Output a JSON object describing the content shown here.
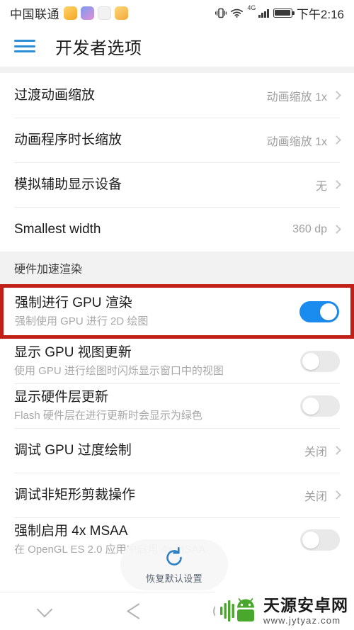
{
  "statusbar": {
    "carrier": "中国联通",
    "app_icons": [
      "app-icon-1",
      "app-icon-2",
      "app-icon-3",
      "app-icon-4"
    ],
    "vibrate_icon": "vibrate-icon",
    "wifi_icon": "wifi-icon",
    "network_type": "4G",
    "signal_icon": "signal-bars-icon",
    "battery_icon": "battery-icon",
    "time": "下午2:16"
  },
  "appbar": {
    "menu_icon": "hamburger-menu-icon",
    "title": "开发者选项"
  },
  "list": [
    {
      "kind": "item",
      "title": "过渡动画缩放",
      "value": "动画缩放 1x"
    },
    {
      "kind": "item",
      "title": "动画程序时长缩放",
      "value": "动画缩放 1x"
    },
    {
      "kind": "item",
      "title": "模拟辅助显示设备",
      "value": "无"
    },
    {
      "kind": "item",
      "title": "Smallest width",
      "value": "360 dp"
    }
  ],
  "section_header": "硬件加速渲染",
  "highlighted_row": {
    "title": "强制进行 GPU 渲染",
    "subtitle": "强制使用 GPU 进行 2D 绘图",
    "toggle_state": "on",
    "highlight_color": "#c02017",
    "toggle_on_color": "#1a8cf0"
  },
  "toggle_rows": [
    {
      "title": "显示 GPU 视图更新",
      "subtitle": "使用 GPU 进行绘图时闪烁显示窗口中的视图",
      "toggle_state": "off"
    },
    {
      "title": "显示硬件层更新",
      "subtitle": "Flash 硬件层在进行更新时会显示为绿色",
      "toggle_state": "off"
    }
  ],
  "value_rows": [
    {
      "title": "调试 GPU 过度绘制",
      "value": "关闭"
    },
    {
      "title": "调试非矩形剪裁操作",
      "value": "关闭"
    }
  ],
  "msaa_row": {
    "title": "强制启用 4x MSAA",
    "subtitle": "在 OpenGL ES 2.0 应用中启用 4x MSAA",
    "toggle_state": "off"
  },
  "restore_button": {
    "icon": "restore-circular-arrow-icon",
    "label": "恢复默认设置"
  },
  "navbar": {
    "collapse_icon": "chevron-down-icon",
    "back_icon": "back-triangle-icon",
    "home_icon": "home-circle-icon"
  },
  "watermark": {
    "logo_icon": "android-robot-logo",
    "title": "天源安卓网",
    "url": "www.jytyaz.com"
  }
}
